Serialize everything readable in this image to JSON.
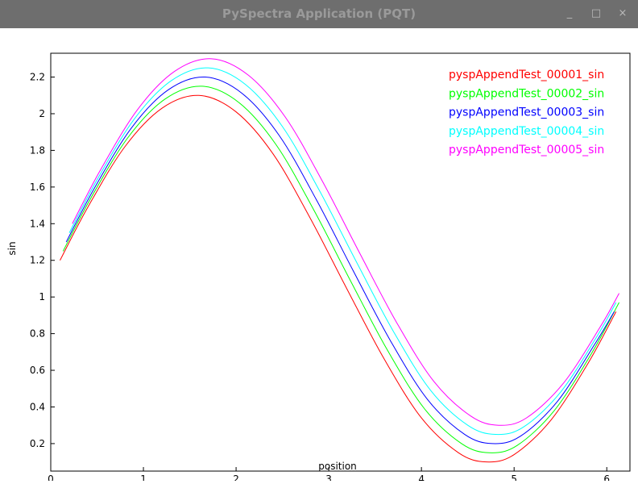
{
  "window": {
    "title": "PySpectra Application (PQT)",
    "minimize_glyph": "_",
    "maximize_glyph": "□",
    "close_glyph": "×"
  },
  "chart_data": {
    "type": "line",
    "xlabel": "position",
    "ylabel": "sin",
    "xlim": [
      0,
      6.25
    ],
    "ylim": [
      0.05,
      2.33
    ],
    "xticks": [
      0,
      1,
      2,
      3,
      4,
      5,
      6
    ],
    "xtick_labels": [
      "0",
      "1",
      "2",
      "3",
      "4",
      "5",
      "6"
    ],
    "yticks": [
      0.2,
      0.4,
      0.6,
      0.8,
      1,
      1.2,
      1.4,
      1.6,
      1.8,
      2,
      2.2
    ],
    "ytick_labels": [
      "0.2",
      "0.4",
      "0.6",
      "0.8",
      "1",
      "1.2",
      "1.4",
      "1.6",
      "1.8",
      "2",
      "2.2"
    ],
    "grid": false,
    "legend_position": "top-right",
    "series": [
      {
        "name": "pyspAppendTest_00001_sin",
        "color": "#ff0000",
        "x": [
          0.1,
          0.4,
          0.8,
          1.2,
          1.6,
          2.0,
          2.4,
          2.8,
          3.2,
          3.6,
          4.0,
          4.4,
          4.7,
          5.0,
          5.4,
          5.8,
          6.1
        ],
        "y": [
          1.2,
          1.49,
          1.82,
          2.03,
          2.1,
          2.01,
          1.78,
          1.43,
          1.04,
          0.66,
          0.34,
          0.15,
          0.1,
          0.14,
          0.33,
          0.64,
          0.92
        ]
      },
      {
        "name": "pyspAppendTest_00002_sin",
        "color": "#00ff00",
        "x": [
          0.133,
          0.433,
          0.833,
          1.233,
          1.633,
          2.033,
          2.433,
          2.833,
          3.233,
          3.633,
          4.033,
          4.433,
          4.733,
          5.033,
          5.433,
          5.833,
          6.133
        ],
        "y": [
          1.25,
          1.54,
          1.87,
          2.08,
          2.15,
          2.06,
          1.83,
          1.48,
          1.09,
          0.71,
          0.39,
          0.2,
          0.15,
          0.19,
          0.38,
          0.69,
          0.97
        ]
      },
      {
        "name": "pyspAppendTest_00003_sin",
        "color": "#0000ff",
        "x": [
          0.167,
          0.467,
          0.867,
          1.267,
          1.667,
          2.067,
          2.467,
          2.867,
          3.267,
          3.667,
          4.067,
          4.467,
          4.767,
          5.067,
          5.467,
          5.867,
          6.08
        ],
        "y": [
          1.3,
          1.59,
          1.92,
          2.13,
          2.2,
          2.11,
          1.88,
          1.53,
          1.14,
          0.76,
          0.44,
          0.25,
          0.2,
          0.24,
          0.43,
          0.74,
          0.92
        ]
      },
      {
        "name": "pyspAppendTest_00004_sin",
        "color": "#00ffff",
        "x": [
          0.2,
          0.5,
          0.9,
          1.3,
          1.7,
          2.1,
          2.5,
          2.9,
          3.3,
          3.7,
          4.1,
          4.5,
          4.8,
          5.1,
          5.5,
          5.9,
          6.1
        ],
        "y": [
          1.35,
          1.64,
          1.97,
          2.18,
          2.25,
          2.16,
          1.93,
          1.58,
          1.19,
          0.81,
          0.49,
          0.3,
          0.25,
          0.29,
          0.48,
          0.79,
          0.97
        ]
      },
      {
        "name": "pyspAppendTest_00005_sin",
        "color": "#ff00ff",
        "x": [
          0.233,
          0.533,
          0.933,
          1.333,
          1.733,
          2.133,
          2.533,
          2.933,
          3.333,
          3.733,
          4.133,
          4.533,
          4.833,
          5.133,
          5.533,
          5.933,
          6.133
        ],
        "y": [
          1.4,
          1.69,
          2.02,
          2.23,
          2.3,
          2.21,
          1.98,
          1.63,
          1.24,
          0.86,
          0.54,
          0.35,
          0.3,
          0.34,
          0.53,
          0.84,
          1.02
        ]
      }
    ]
  }
}
